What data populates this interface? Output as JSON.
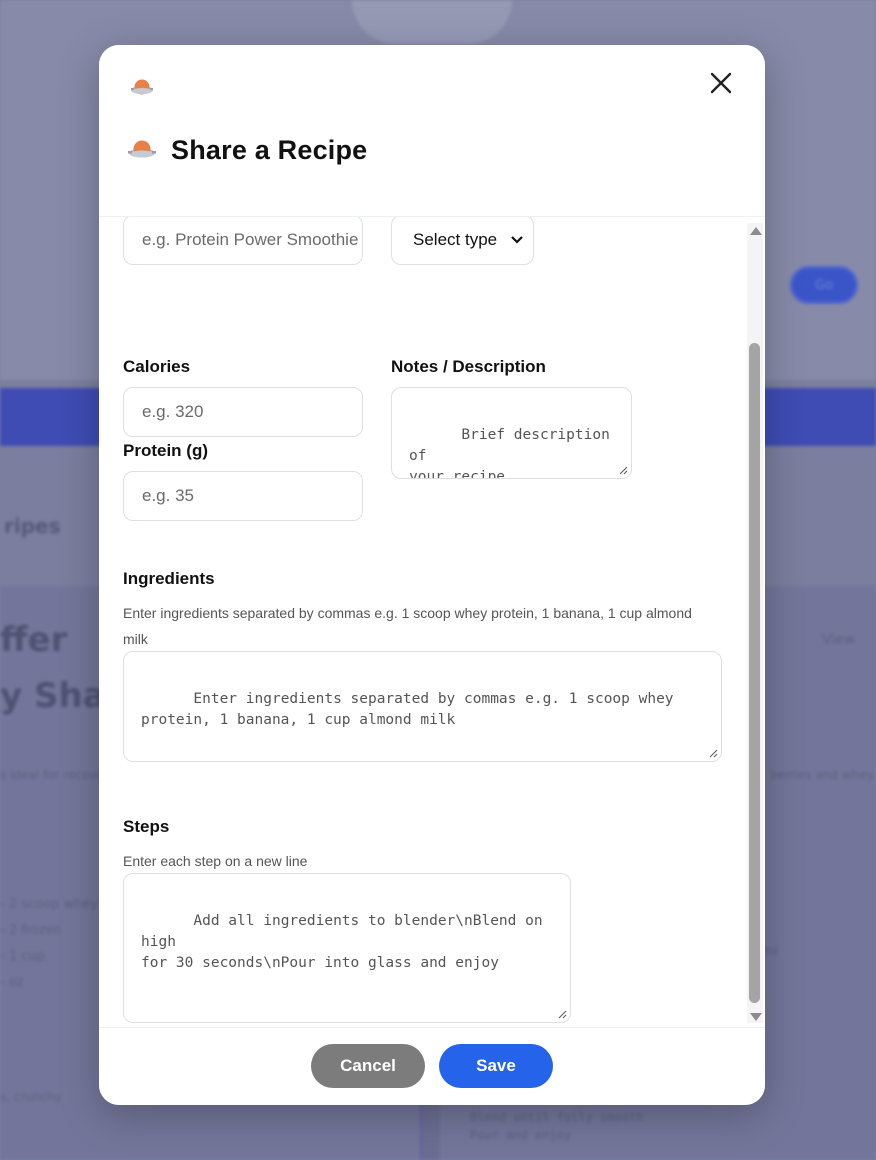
{
  "background": {
    "pill": "Go",
    "section_tab": "ripes",
    "title_line1": "ffer",
    "title_line2": "y Sha",
    "right_link": "View",
    "desc_left": "s ideal for recovery.",
    "desc_right": "berries and whey.",
    "list_items": [
      "- 2 scoop whey",
      "- 2 frozen",
      "- 1 cup",
      "- oz"
    ],
    "right_bits": "ml",
    "bottom_left": "s, crunchy",
    "bottom_right": [
      "Blend until fully smooth",
      "Pour and enjoy"
    ]
  },
  "modal": {
    "title": "Share a Recipe",
    "header_icon": "recipe-pot-icon",
    "close_icon": "close-icon",
    "fields": {
      "name": {
        "placeholder": "e.g. Protein Power Smoothie"
      },
      "type": {
        "value": "Select type"
      },
      "calories": {
        "label": "Calories",
        "placeholder": "e.g. 320"
      },
      "protein": {
        "label": "Protein (g)",
        "placeholder": "e.g. 35"
      },
      "notes": {
        "label": "Notes / Description",
        "placeholder": "Brief description of\nyour recipe..."
      },
      "ingredients": {
        "label": "Ingredients",
        "hint": "Enter ingredients separated by commas e.g. 1 scoop whey protein, 1 banana, 1 cup almond milk",
        "placeholder": "Enter ingredients separated by commas e.g. 1 scoop whey\nprotein, 1 banana, 1 cup almond milk"
      },
      "steps": {
        "label": "Steps",
        "hint": "Enter each step on a new line",
        "placeholder": "Add all ingredients to blender\\nBlend on high\nfor 30 seconds\\nPour into glass and enjoy"
      }
    },
    "buttons": {
      "cancel": "Cancel",
      "save": "Save"
    },
    "colors": {
      "save": "#2563eb",
      "cancel": "#7c7c7c",
      "overlay": "#7c7f9f"
    }
  }
}
